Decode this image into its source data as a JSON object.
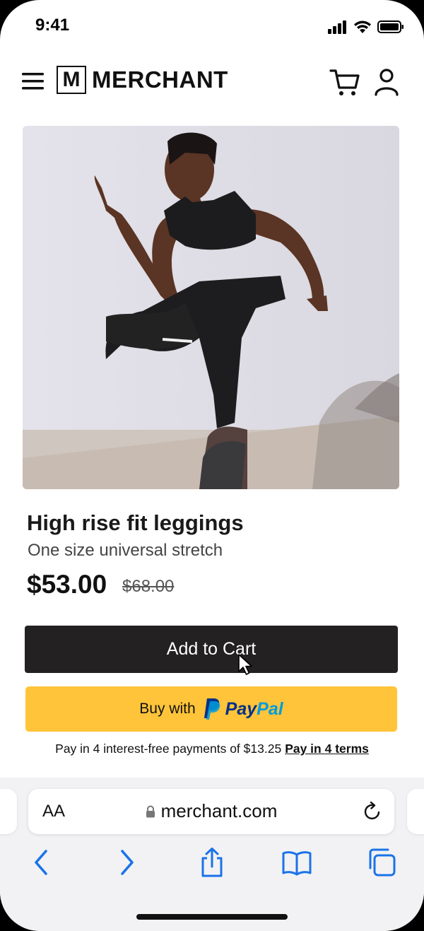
{
  "status_bar": {
    "time": "9:41"
  },
  "header": {
    "logo_letter": "M",
    "brand": "MERCHANT"
  },
  "product": {
    "title": "High rise fit leggings",
    "subtitle": "One size universal stretch",
    "price": "$53.00",
    "compare_at_price": "$68.00"
  },
  "actions": {
    "add_to_cart": "Add to Cart",
    "buy_with": "Buy with",
    "paypal_pay": "Pay",
    "paypal_pal": "Pal",
    "installments_text": "Pay in 4 interest-free payments of $13.25",
    "installments_link": "Pay in 4 terms"
  },
  "browser": {
    "text_size": "AA",
    "url": "merchant.com"
  },
  "colors": {
    "add_to_cart_bg": "#232122",
    "paypal_yellow": "#FFC439",
    "paypal_dark_blue": "#003087",
    "paypal_light_blue": "#009CDE",
    "browser_accent": "#1a73e8"
  },
  "icons": [
    "hamburger-menu-icon",
    "cart-icon",
    "user-icon",
    "lock-icon",
    "reload-icon",
    "back-icon",
    "forward-icon",
    "share-icon",
    "bookmarks-icon",
    "tabs-icon"
  ]
}
